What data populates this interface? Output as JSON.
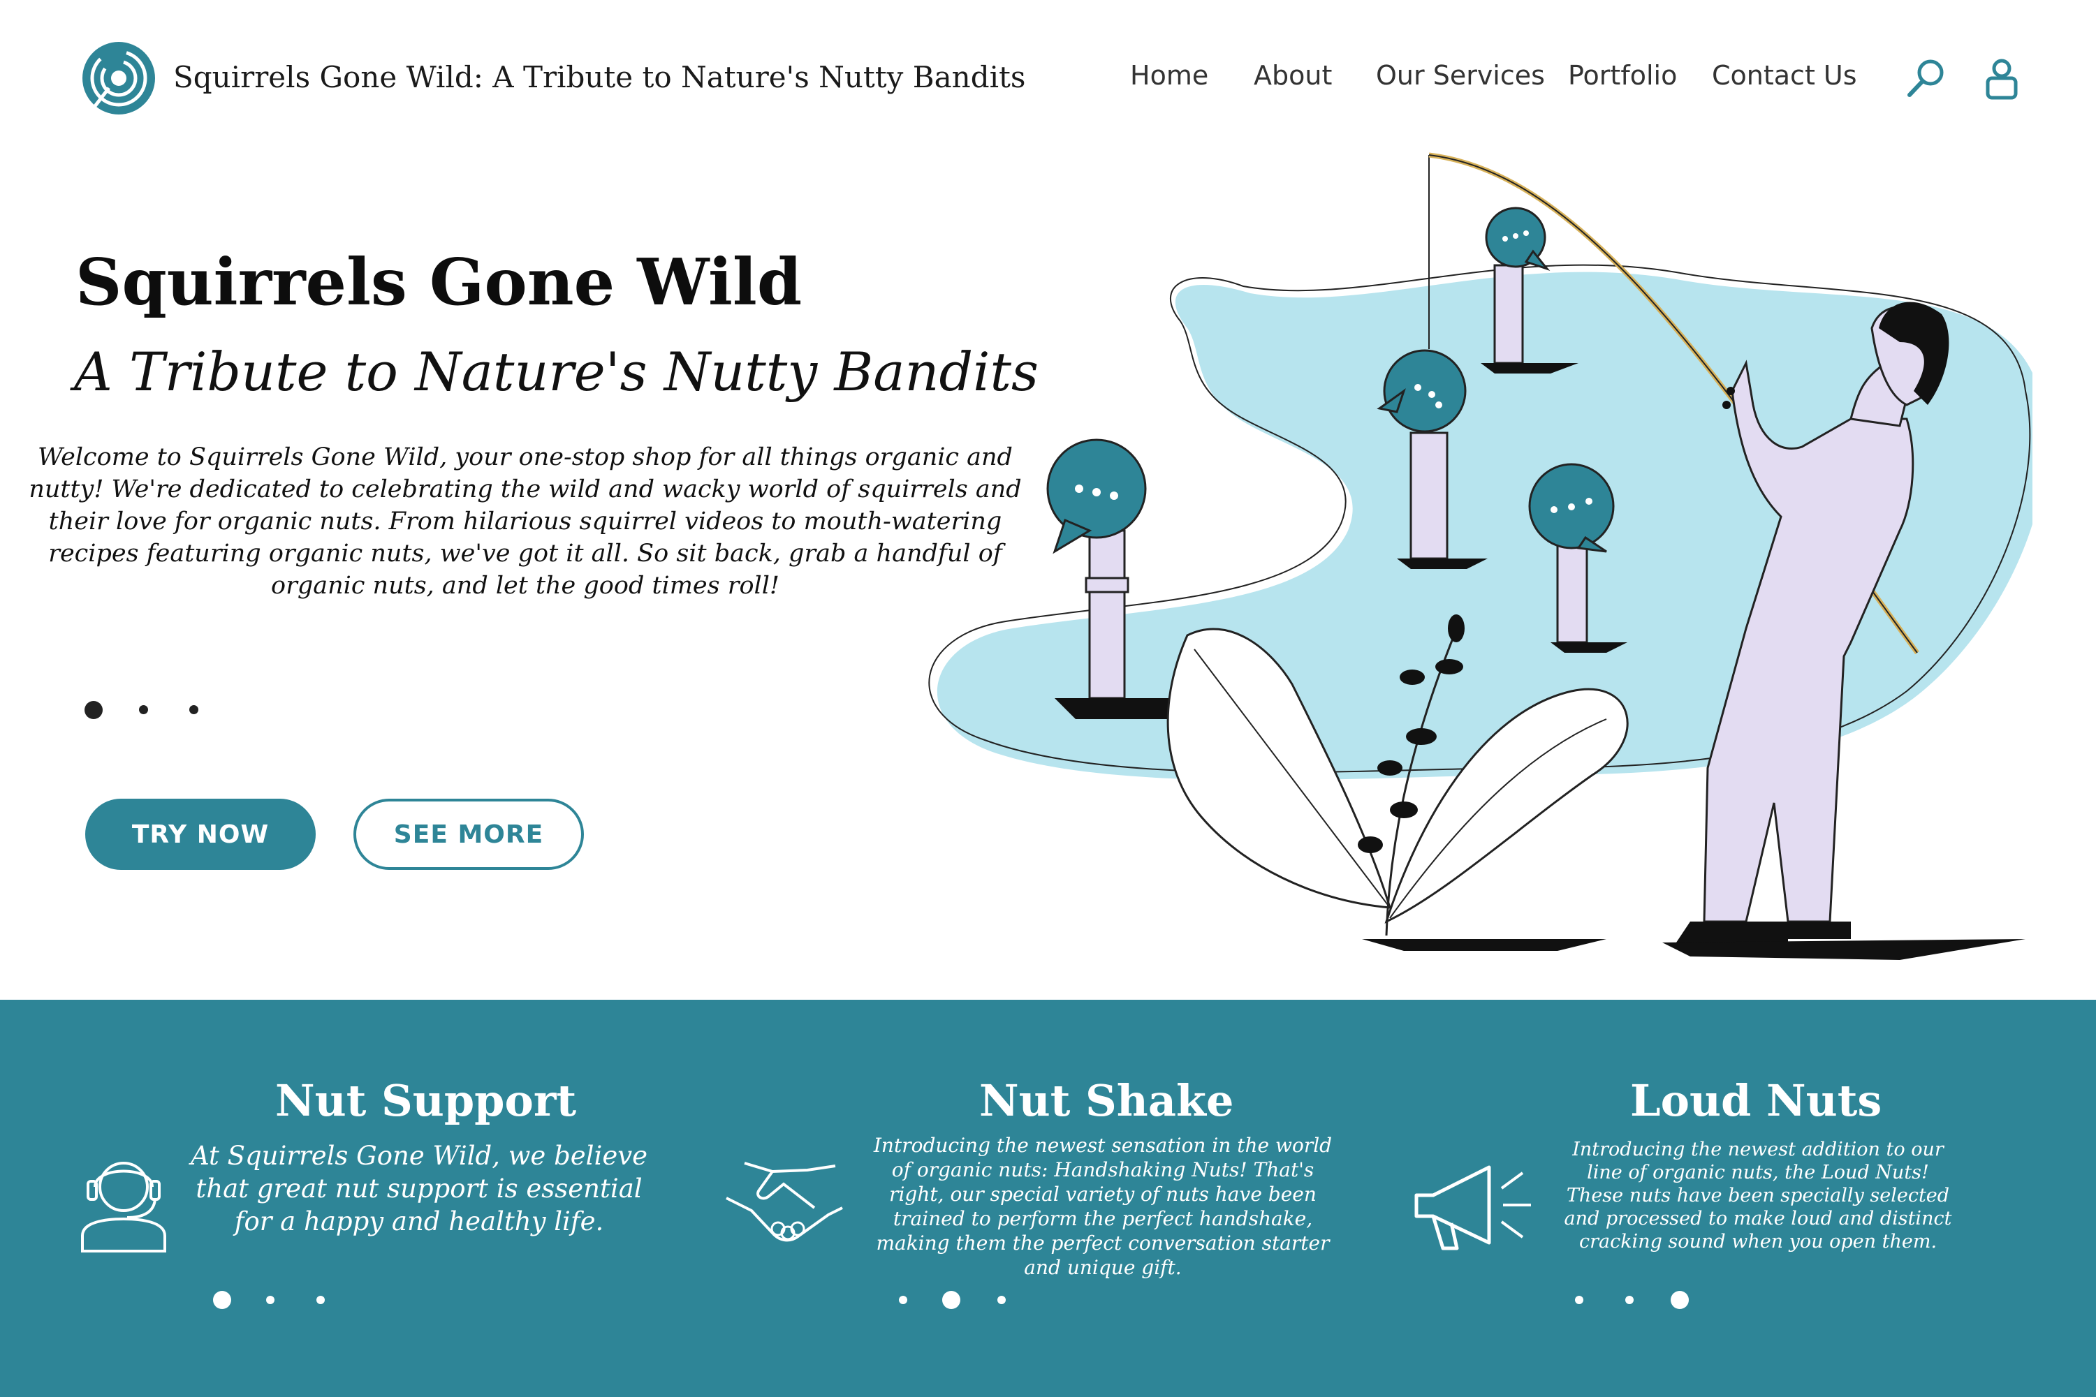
{
  "header": {
    "site_title": "Squirrels Gone Wild: A Tribute to Nature's Nutty Bandits",
    "nav": [
      "Home",
      "About",
      "Our Services",
      "Portfolio",
      "Contact Us"
    ]
  },
  "hero": {
    "title": "Squirrels Gone Wild",
    "subtitle": "A Tribute to Nature's Nutty Bandits",
    "body": "Welcome to Squirrels Gone Wild, your one-stop shop for all things organic and nutty! We're dedicated to celebrating the wild and wacky world of squirrels and their love for organic nuts. From hilarious squirrel videos to mouth-watering recipes featuring organic nuts, we've got it all. So sit back, grab a handful of organic nuts, and let the good times roll!",
    "carousel": {
      "total": 3,
      "active": 1
    },
    "buttons": {
      "primary": "TRY NOW",
      "secondary": "SEE MORE"
    }
  },
  "features": [
    {
      "icon": "headset-support-icon",
      "title": "Nut Support",
      "text": "At Squirrels Gone Wild, we believe that great nut support is essential for a happy and healthy life.",
      "carousel": {
        "total": 3,
        "active": 1
      }
    },
    {
      "icon": "handshake-icon",
      "title": "Nut Shake",
      "text": "Introducing the newest sensation in the world of organic nuts: Handshaking Nuts! That's right, our special variety of nuts have been trained to perform the perfect handshake, making them the perfect conversation starter and unique gift.",
      "carousel": {
        "total": 3,
        "active": 2
      }
    },
    {
      "icon": "megaphone-icon",
      "title": "Loud Nuts",
      "text": "Introducing the newest addition to our line of organic nuts, the Loud Nuts! These nuts have been specially selected and processed to make loud and distinct cracking sound when you open them.",
      "carousel": {
        "total": 3,
        "active": 3
      }
    }
  ],
  "colors": {
    "brand": "#2e8597",
    "blob": "#b7e4ee",
    "figure": "#e3dcf2",
    "text": "#111111",
    "band_text": "#ffffff"
  }
}
